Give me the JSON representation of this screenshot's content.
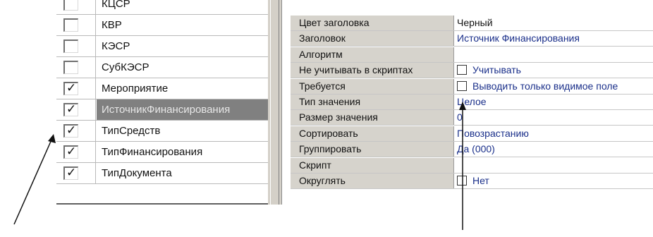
{
  "field_list": {
    "rows": [
      {
        "label": "КЦСР",
        "checked": false,
        "selected": false
      },
      {
        "label": "КВР",
        "checked": false,
        "selected": false
      },
      {
        "label": "КЭСР",
        "checked": false,
        "selected": false
      },
      {
        "label": "СубКЭСР",
        "checked": false,
        "selected": false
      },
      {
        "label": "Мероприятие",
        "checked": true,
        "selected": false
      },
      {
        "label": "ИсточникФинансирования",
        "checked": true,
        "selected": true
      },
      {
        "label": "ТипСредств",
        "checked": true,
        "selected": false
      },
      {
        "label": "ТипФинансирования",
        "checked": true,
        "selected": false
      },
      {
        "label": "ТипДокумента",
        "checked": true,
        "selected": false
      }
    ],
    "check_glyph": "✓"
  },
  "properties": {
    "rows": [
      {
        "name": "Цвет заголовка",
        "value": "Черный",
        "checkbox": false,
        "value_color": "black"
      },
      {
        "name": "Заголовок",
        "value": "Источник Финансирования",
        "checkbox": false
      },
      {
        "name": "Алгоритм",
        "value": "",
        "checkbox": false
      },
      {
        "name": "Не учитывать в скриптах",
        "value": "Учитывать",
        "checkbox": true
      },
      {
        "name": "Требуется",
        "value": "Выводить только видимое поле",
        "checkbox": true
      },
      {
        "name": "Тип значения",
        "value": "Целое",
        "checkbox": false
      },
      {
        "name": "Размер значения",
        "value": "0",
        "checkbox": false
      },
      {
        "name": "Сортировать",
        "value": "Повозрастанию",
        "checkbox": false
      },
      {
        "name": "Группировать",
        "value": "Да (000)",
        "checkbox": false
      },
      {
        "name": "Скрипт",
        "value": "",
        "checkbox": false
      },
      {
        "name": "Округлять",
        "value": "Нет",
        "checkbox": true
      }
    ]
  },
  "colors": {
    "selected_row_bg": "#808080",
    "value_text": "#1a2f8a",
    "name_column_bg": "#d6d3cc"
  }
}
